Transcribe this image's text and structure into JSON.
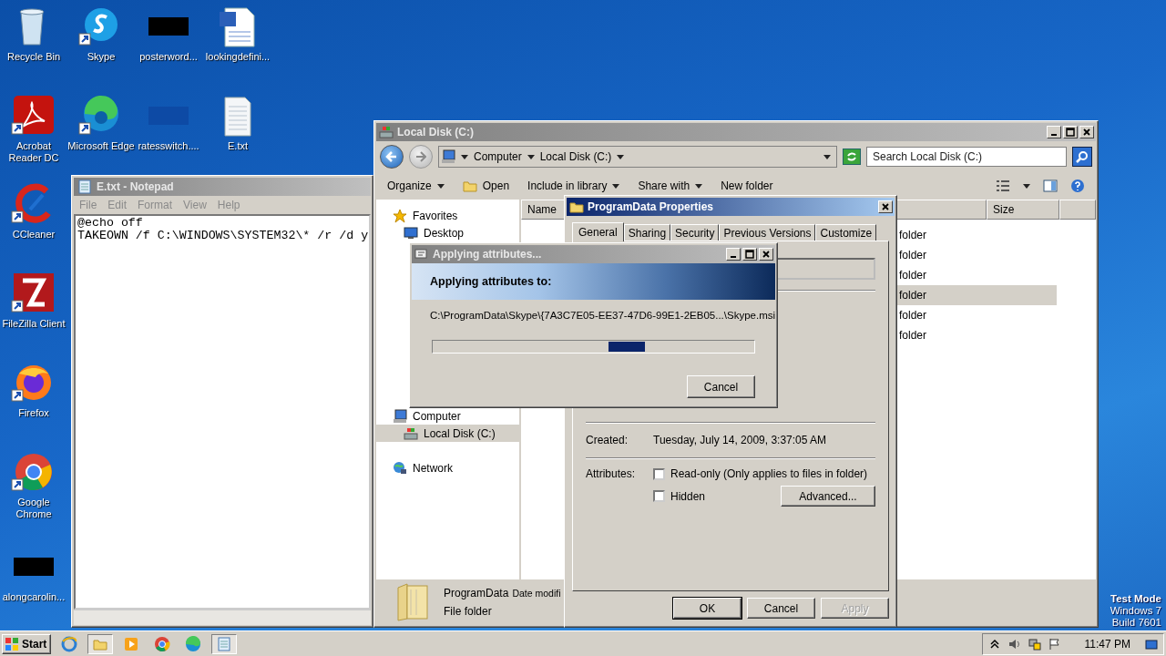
{
  "desktop_icons": [
    {
      "label": "Recycle Bin",
      "kind": "recycle"
    },
    {
      "label": "Skype",
      "kind": "skype"
    },
    {
      "label": "posterword...",
      "kind": "redacted"
    },
    {
      "label": "lookingdefini...",
      "kind": "word"
    },
    {
      "label": "Acrobat Reader DC",
      "kind": "acrobat"
    },
    {
      "label": "Microsoft Edge",
      "kind": "edge"
    },
    {
      "label": "ratesswitch....",
      "kind": "blank"
    },
    {
      "label": "E.txt",
      "kind": "text"
    },
    {
      "label": "CCleaner",
      "kind": "ccleaner"
    },
    {
      "label": "FileZilla Client",
      "kind": "filezilla"
    },
    {
      "label": "Firefox",
      "kind": "firefox"
    },
    {
      "label": "Google Chrome",
      "kind": "chrome"
    },
    {
      "label": "alongcarolin...",
      "kind": "redacted"
    }
  ],
  "os_notice": [
    "Test Mode",
    "Windows 7",
    "Build 7601"
  ],
  "notepad": {
    "title": "E.txt - Notepad",
    "menu": [
      "File",
      "Edit",
      "Format",
      "View",
      "Help"
    ],
    "lines": [
      "@echo off",
      "TAKEOWN /f C:\\WINDOWS\\SYSTEM32\\* /r /d y"
    ]
  },
  "explorer": {
    "title": "Local Disk (C:)",
    "breadcrumb": [
      "Computer",
      "Local Disk (C:)"
    ],
    "search": {
      "placeholder": "Search Local Disk (C:)"
    },
    "toolbar": [
      {
        "label": "Organize",
        "kind": "menu"
      },
      {
        "label": "Open",
        "kind": "open"
      },
      {
        "label": "Include in library",
        "kind": "menu"
      },
      {
        "label": "Share with",
        "kind": "menu"
      },
      {
        "label": "New folder",
        "kind": "plain"
      }
    ],
    "nav": [
      {
        "label": "Favorites",
        "kind": "star",
        "selected": false,
        "children": [
          {
            "label": "Desktop",
            "kind": "desktop",
            "selected": false
          }
        ]
      },
      {
        "label": "Computer",
        "kind": "computer",
        "selected": false,
        "children": [
          {
            "label": "Local Disk (C:)",
            "kind": "disk",
            "selected": true
          }
        ]
      },
      {
        "label": "Network",
        "kind": "network",
        "selected": false
      }
    ],
    "columns": [
      "Name",
      "Size"
    ],
    "rows": [
      {
        "type_column": "folder",
        "selected": false
      },
      {
        "type_column": "folder",
        "selected": false
      },
      {
        "type_column": "folder",
        "selected": false
      },
      {
        "type_column": "folder",
        "selected": true
      },
      {
        "type_column": "folder",
        "selected": false
      },
      {
        "type_column": "folder",
        "selected": false
      }
    ],
    "details": {
      "name": "ProgramData",
      "date_label": "Date modifi",
      "type": "File folder"
    }
  },
  "properties": {
    "title": "ProgramData Properties",
    "tabs": [
      {
        "label": "General",
        "selected": true
      },
      {
        "label": "Sharing",
        "selected": false
      },
      {
        "label": "Security",
        "selected": false
      },
      {
        "label": "Previous Versions",
        "selected": false
      },
      {
        "label": "Customize",
        "selected": false
      }
    ],
    "created": {
      "label": "Created:",
      "value": "Tuesday, July 14, 2009, 3:37:05 AM"
    },
    "attributes_label": "Attributes:",
    "checkboxes": [
      {
        "label": "Read-only (Only applies to files in folder)",
        "checked": false
      },
      {
        "label": "Hidden",
        "checked": false
      }
    ],
    "advanced_button": "Advanced...",
    "buttons": [
      {
        "label": "OK",
        "disabled": false,
        "default": true
      },
      {
        "label": "Cancel",
        "disabled": false,
        "default": false
      },
      {
        "label": "Apply",
        "disabled": true,
        "default": false
      }
    ]
  },
  "applying": {
    "title": "Applying attributes...",
    "heading": "Applying attributes to:",
    "path": "C:\\ProgramData\\Skype\\{7A3C7E05-EE37-47D6-99E1-2EB05...\\Skype.msi",
    "cancel": "Cancel"
  },
  "taskbar": {
    "start": "Start",
    "apps": [
      {
        "kind": "ie",
        "active": false
      },
      {
        "kind": "explorer",
        "active": true
      },
      {
        "kind": "media",
        "active": false
      },
      {
        "kind": "chrome",
        "active": false
      },
      {
        "kind": "edge",
        "active": false
      },
      {
        "kind": "notepad",
        "active": true
      }
    ],
    "clock": "11:47 PM"
  }
}
